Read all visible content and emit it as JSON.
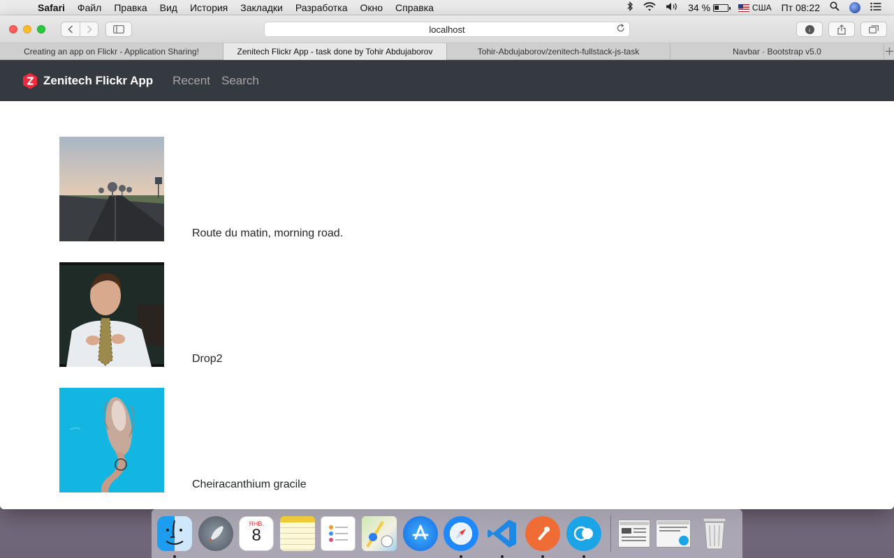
{
  "menubar": {
    "app_name": "Safari",
    "items": [
      "Файл",
      "Правка",
      "Вид",
      "История",
      "Закладки",
      "Разработка",
      "Окно",
      "Справка"
    ],
    "battery": "34 %",
    "input_source": "США",
    "clock": "Пт 08:22"
  },
  "browser": {
    "url": "localhost",
    "tabs": [
      {
        "title": "Creating an app on Flickr - Application Sharing!"
      },
      {
        "title": "Zenitech Flickr App - task done by Tohir Abdujaborov"
      },
      {
        "title": "Tohir-Abdujaborov/zenitech-fullstack-js-task"
      },
      {
        "title": "Navbar · Bootstrap v5.0"
      }
    ],
    "active_tab_index": 1
  },
  "navbar": {
    "brand": "Zenitech Flickr App",
    "links": [
      "Recent",
      "Search"
    ]
  },
  "photos": [
    {
      "title": "Route du matin, morning road."
    },
    {
      "title": "Drop2"
    },
    {
      "title": "Cheiracanthium gracile"
    }
  ],
  "dock": {
    "calendar_month": "ЯНВ.",
    "calendar_day": "8",
    "apps": [
      "Finder",
      "Launchpad",
      "Calendar",
      "Notes",
      "Reminders",
      "Maps",
      "App Store",
      "Safari",
      "Visual Studio Code",
      "Postman",
      "App",
      "Preview",
      "Screenshot",
      "Trash"
    ]
  }
}
